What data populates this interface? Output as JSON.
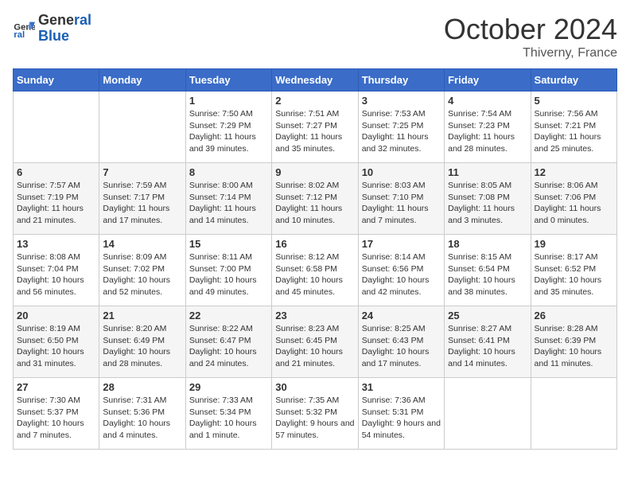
{
  "header": {
    "logo_line1": "General",
    "logo_line2": "Blue",
    "month": "October 2024",
    "location": "Thiverny, France"
  },
  "weekdays": [
    "Sunday",
    "Monday",
    "Tuesday",
    "Wednesday",
    "Thursday",
    "Friday",
    "Saturday"
  ],
  "weeks": [
    [
      {
        "day": "",
        "sunrise": "",
        "sunset": "",
        "daylight": ""
      },
      {
        "day": "",
        "sunrise": "",
        "sunset": "",
        "daylight": ""
      },
      {
        "day": "1",
        "sunrise": "Sunrise: 7:50 AM",
        "sunset": "Sunset: 7:29 PM",
        "daylight": "Daylight: 11 hours and 39 minutes."
      },
      {
        "day": "2",
        "sunrise": "Sunrise: 7:51 AM",
        "sunset": "Sunset: 7:27 PM",
        "daylight": "Daylight: 11 hours and 35 minutes."
      },
      {
        "day": "3",
        "sunrise": "Sunrise: 7:53 AM",
        "sunset": "Sunset: 7:25 PM",
        "daylight": "Daylight: 11 hours and 32 minutes."
      },
      {
        "day": "4",
        "sunrise": "Sunrise: 7:54 AM",
        "sunset": "Sunset: 7:23 PM",
        "daylight": "Daylight: 11 hours and 28 minutes."
      },
      {
        "day": "5",
        "sunrise": "Sunrise: 7:56 AM",
        "sunset": "Sunset: 7:21 PM",
        "daylight": "Daylight: 11 hours and 25 minutes."
      }
    ],
    [
      {
        "day": "6",
        "sunrise": "Sunrise: 7:57 AM",
        "sunset": "Sunset: 7:19 PM",
        "daylight": "Daylight: 11 hours and 21 minutes."
      },
      {
        "day": "7",
        "sunrise": "Sunrise: 7:59 AM",
        "sunset": "Sunset: 7:17 PM",
        "daylight": "Daylight: 11 hours and 17 minutes."
      },
      {
        "day": "8",
        "sunrise": "Sunrise: 8:00 AM",
        "sunset": "Sunset: 7:14 PM",
        "daylight": "Daylight: 11 hours and 14 minutes."
      },
      {
        "day": "9",
        "sunrise": "Sunrise: 8:02 AM",
        "sunset": "Sunset: 7:12 PM",
        "daylight": "Daylight: 11 hours and 10 minutes."
      },
      {
        "day": "10",
        "sunrise": "Sunrise: 8:03 AM",
        "sunset": "Sunset: 7:10 PM",
        "daylight": "Daylight: 11 hours and 7 minutes."
      },
      {
        "day": "11",
        "sunrise": "Sunrise: 8:05 AM",
        "sunset": "Sunset: 7:08 PM",
        "daylight": "Daylight: 11 hours and 3 minutes."
      },
      {
        "day": "12",
        "sunrise": "Sunrise: 8:06 AM",
        "sunset": "Sunset: 7:06 PM",
        "daylight": "Daylight: 11 hours and 0 minutes."
      }
    ],
    [
      {
        "day": "13",
        "sunrise": "Sunrise: 8:08 AM",
        "sunset": "Sunset: 7:04 PM",
        "daylight": "Daylight: 10 hours and 56 minutes."
      },
      {
        "day": "14",
        "sunrise": "Sunrise: 8:09 AM",
        "sunset": "Sunset: 7:02 PM",
        "daylight": "Daylight: 10 hours and 52 minutes."
      },
      {
        "day": "15",
        "sunrise": "Sunrise: 8:11 AM",
        "sunset": "Sunset: 7:00 PM",
        "daylight": "Daylight: 10 hours and 49 minutes."
      },
      {
        "day": "16",
        "sunrise": "Sunrise: 8:12 AM",
        "sunset": "Sunset: 6:58 PM",
        "daylight": "Daylight: 10 hours and 45 minutes."
      },
      {
        "day": "17",
        "sunrise": "Sunrise: 8:14 AM",
        "sunset": "Sunset: 6:56 PM",
        "daylight": "Daylight: 10 hours and 42 minutes."
      },
      {
        "day": "18",
        "sunrise": "Sunrise: 8:15 AM",
        "sunset": "Sunset: 6:54 PM",
        "daylight": "Daylight: 10 hours and 38 minutes."
      },
      {
        "day": "19",
        "sunrise": "Sunrise: 8:17 AM",
        "sunset": "Sunset: 6:52 PM",
        "daylight": "Daylight: 10 hours and 35 minutes."
      }
    ],
    [
      {
        "day": "20",
        "sunrise": "Sunrise: 8:19 AM",
        "sunset": "Sunset: 6:50 PM",
        "daylight": "Daylight: 10 hours and 31 minutes."
      },
      {
        "day": "21",
        "sunrise": "Sunrise: 8:20 AM",
        "sunset": "Sunset: 6:49 PM",
        "daylight": "Daylight: 10 hours and 28 minutes."
      },
      {
        "day": "22",
        "sunrise": "Sunrise: 8:22 AM",
        "sunset": "Sunset: 6:47 PM",
        "daylight": "Daylight: 10 hours and 24 minutes."
      },
      {
        "day": "23",
        "sunrise": "Sunrise: 8:23 AM",
        "sunset": "Sunset: 6:45 PM",
        "daylight": "Daylight: 10 hours and 21 minutes."
      },
      {
        "day": "24",
        "sunrise": "Sunrise: 8:25 AM",
        "sunset": "Sunset: 6:43 PM",
        "daylight": "Daylight: 10 hours and 17 minutes."
      },
      {
        "day": "25",
        "sunrise": "Sunrise: 8:27 AM",
        "sunset": "Sunset: 6:41 PM",
        "daylight": "Daylight: 10 hours and 14 minutes."
      },
      {
        "day": "26",
        "sunrise": "Sunrise: 8:28 AM",
        "sunset": "Sunset: 6:39 PM",
        "daylight": "Daylight: 10 hours and 11 minutes."
      }
    ],
    [
      {
        "day": "27",
        "sunrise": "Sunrise: 7:30 AM",
        "sunset": "Sunset: 5:37 PM",
        "daylight": "Daylight: 10 hours and 7 minutes."
      },
      {
        "day": "28",
        "sunrise": "Sunrise: 7:31 AM",
        "sunset": "Sunset: 5:36 PM",
        "daylight": "Daylight: 10 hours and 4 minutes."
      },
      {
        "day": "29",
        "sunrise": "Sunrise: 7:33 AM",
        "sunset": "Sunset: 5:34 PM",
        "daylight": "Daylight: 10 hours and 1 minute."
      },
      {
        "day": "30",
        "sunrise": "Sunrise: 7:35 AM",
        "sunset": "Sunset: 5:32 PM",
        "daylight": "Daylight: 9 hours and 57 minutes."
      },
      {
        "day": "31",
        "sunrise": "Sunrise: 7:36 AM",
        "sunset": "Sunset: 5:31 PM",
        "daylight": "Daylight: 9 hours and 54 minutes."
      },
      {
        "day": "",
        "sunrise": "",
        "sunset": "",
        "daylight": ""
      },
      {
        "day": "",
        "sunrise": "",
        "sunset": "",
        "daylight": ""
      }
    ]
  ]
}
